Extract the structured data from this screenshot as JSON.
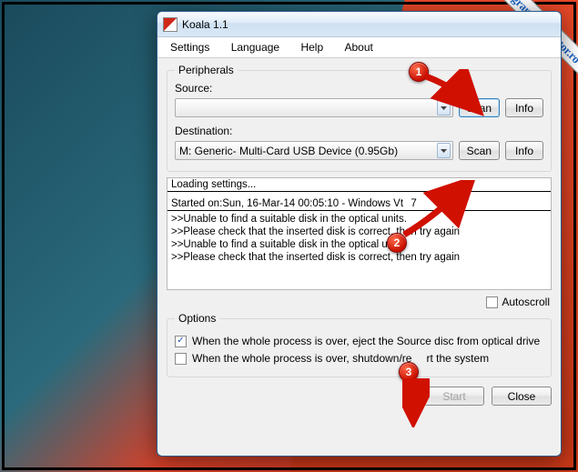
{
  "ribbon": "programecalculator.ro",
  "window": {
    "title": "Koala 1.1",
    "menu": {
      "settings": "Settings",
      "language": "Language",
      "help": "Help",
      "about": "About"
    }
  },
  "peripherals": {
    "legend": "Peripherals",
    "source_label": "Source:",
    "source_value": "",
    "dest_label": "Destination:",
    "dest_value": "M: Generic- Multi-Card USB Device (0.95Gb)",
    "scan": "Scan",
    "info": "Info"
  },
  "log": {
    "head": "Loading settings...",
    "started": "Started on:Sun, 16-Mar-14 00:05:10 - Windows Vt",
    "started_tail": "7",
    "lines": [
      ">>Unable to find a suitable disk in the optical units.",
      ">>Please check that the inserted disk is correct, then try again",
      ">>Unable to find a suitable disk in the optical units.",
      ">>Please check that the inserted disk is correct, then try again"
    ]
  },
  "autoscroll_label": "Autoscroll",
  "options": {
    "legend": "Options",
    "eject": "When the whole process is over, eject the Source disc from optical drive",
    "shutdown_a": "When the whole process is over, shutdown/re",
    "shutdown_b": "rt the system"
  },
  "buttons": {
    "start": "Start",
    "close": "Close"
  },
  "badges": {
    "one": "1",
    "two": "2",
    "three": "3"
  }
}
